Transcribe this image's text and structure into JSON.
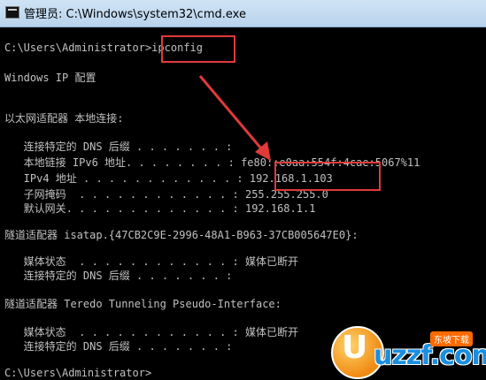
{
  "window": {
    "title": "管理员: C:\\Windows\\system32\\cmd.exe"
  },
  "console": {
    "lines": [
      "C:\\Users\\Administrator>ipconfig",
      "Windows IP 配置",
      "以太网适配器 本地连接:",
      "   连接特定的 DNS 后缀 . . . . . . . :",
      "   本地链接 IPv6 地址. . . . . . . . : fe80::e0aa:554f:4cae:5067%11",
      "   IPv4 地址 . . . . . . . . . . . . : 192.168.1.103",
      "   子网掩码  . . . . . . . . . . . . : 255.255.255.0",
      "   默认网关. . . . . . . . . . . . . : 192.168.1.1",
      "隧道适配器 isatap.{47CB2C9E-2996-48A1-B963-37CB005647E0}:",
      "   媒体状态  . . . . . . . . . . . . : 媒体已断开",
      "   连接特定的 DNS 后缀 . . . . . . . :",
      "隧道适配器 Teredo Tunneling Pseudo-Interface:",
      "   媒体状态  . . . . . . . . . . . . : 媒体已断开",
      "   连接特定的 DNS 后缀 . . . . . . . :",
      "C:\\Users\\Administrator>"
    ]
  },
  "colors": {
    "console_bg": "#000000",
    "console_text": "#c0c0c0",
    "annotation": "#e03a3a"
  },
  "watermark": {
    "text": "uzzf.com",
    "badge": "东坡下载"
  }
}
